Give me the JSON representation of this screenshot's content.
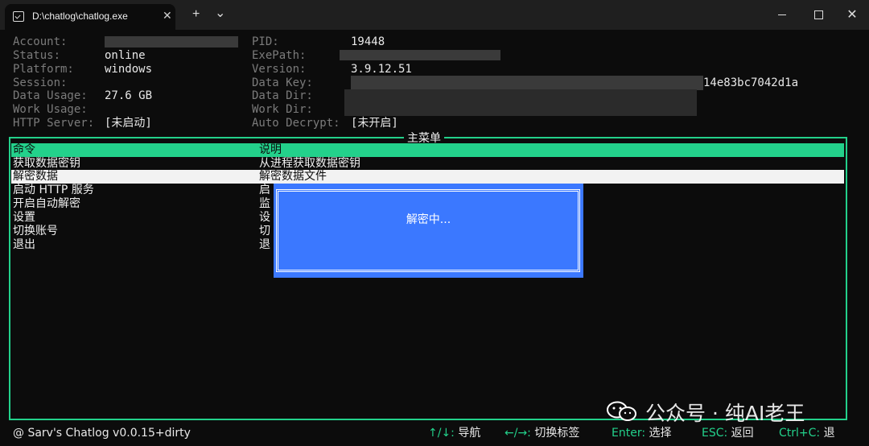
{
  "window": {
    "tab_title": "D:\\chatlog\\chatlog.exe",
    "tab_close": "✕",
    "new_tab": "+",
    "dropdown": "⌄",
    "close": "✕"
  },
  "info": {
    "account_label": "Account:",
    "status_label": "Status:",
    "status_value": "online",
    "platform_label": "Platform:",
    "platform_value": "windows",
    "session_label": "Session:",
    "data_usage_label": "Data Usage:",
    "data_usage_value": "27.6 GB",
    "work_usage_label": "Work Usage:",
    "http_server_label": "HTTP Server:",
    "http_server_value": "[未启动]",
    "pid_label": "PID:",
    "pid_value": "19448",
    "exepath_label": "ExePath:",
    "version_label": "Version:",
    "version_value": "3.9.12.51",
    "data_key_label": "Data Key:",
    "data_key_value": "14e83bc7042d1a",
    "data_dir_label": "Data Dir:",
    "work_dir_label": "Work Dir:",
    "auto_decrypt_label": "Auto Decrypt:",
    "auto_decrypt_value": "[未开启]"
  },
  "menu": {
    "title": "主菜单",
    "header": {
      "col1": "命令",
      "col2": "说明"
    },
    "items": [
      {
        "cmd": "获取数据密钥",
        "desc": "从进程获取数据密钥"
      },
      {
        "cmd": "解密数据",
        "desc": "解密数据文件"
      },
      {
        "cmd": "启动 HTTP 服务",
        "desc": "启"
      },
      {
        "cmd": "开启自动解密",
        "desc": "监"
      },
      {
        "cmd": "设置",
        "desc": "设"
      },
      {
        "cmd": "切换账号",
        "desc": "切"
      },
      {
        "cmd": "退出",
        "desc": "退"
      }
    ],
    "selected_index": 1
  },
  "dialog": {
    "text": "解密中..."
  },
  "footer": {
    "app": "@ Sarv's Chatlog v0.0.15+dirty",
    "nav_key": "↑/↓:",
    "nav_label": " 导航",
    "tab_key": "←/→:",
    "tab_label": " 切换标签",
    "enter_key": "Enter:",
    "enter_label": " 选择",
    "esc_key": "ESC:",
    "esc_label": " 返回",
    "ctrl_key": "Ctrl+C:",
    "ctrl_label": " 退"
  },
  "watermark": {
    "text": "公众号 · 纯AI老王"
  },
  "colors": {
    "accent": "#23d18b",
    "dialog": "#3b78ff",
    "background": "#0c0c0c"
  }
}
